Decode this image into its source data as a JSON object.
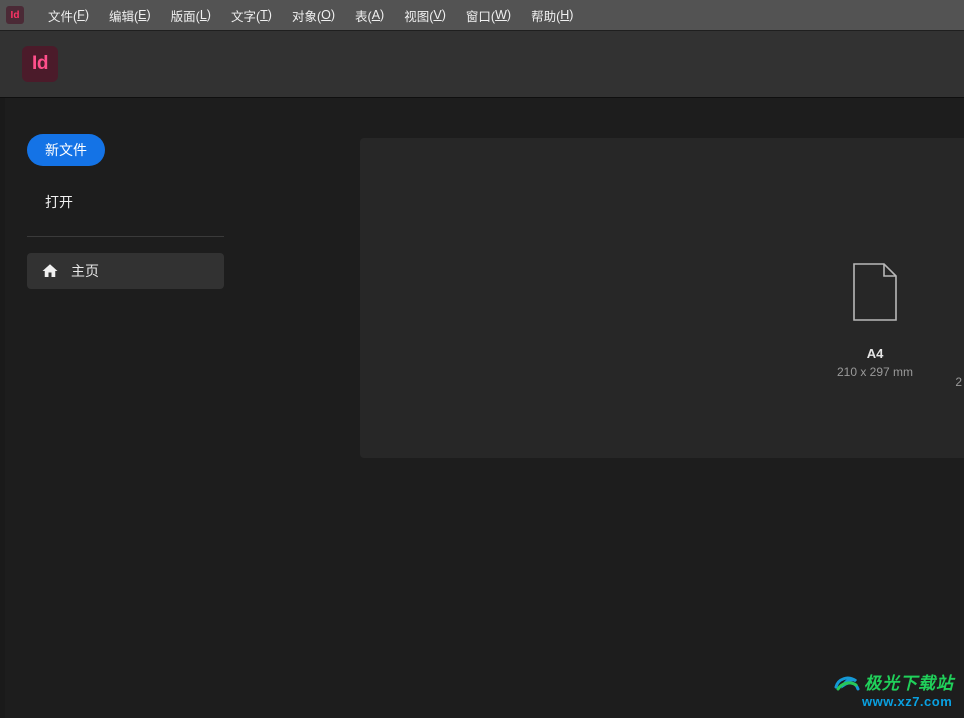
{
  "menubar": {
    "app_glyph": "Id",
    "items": [
      {
        "label_pre": "文件(",
        "hot": "F",
        "label_post": ")"
      },
      {
        "label_pre": "编辑(",
        "hot": "E",
        "label_post": ")"
      },
      {
        "label_pre": "版面(",
        "hot": "L",
        "label_post": ")"
      },
      {
        "label_pre": "文字(",
        "hot": "T",
        "label_post": ")"
      },
      {
        "label_pre": "对象(",
        "hot": "O",
        "label_post": ")"
      },
      {
        "label_pre": "表(",
        "hot": "A",
        "label_post": ")"
      },
      {
        "label_pre": "视图(",
        "hot": "V",
        "label_post": ")"
      },
      {
        "label_pre": "窗口(",
        "hot": "W",
        "label_post": ")"
      },
      {
        "label_pre": "帮助(",
        "hot": "H",
        "label_post": ")"
      }
    ]
  },
  "brand": {
    "logo_text": "Id"
  },
  "sidebar": {
    "new_file": "新文件",
    "open": "打开",
    "home": "主页"
  },
  "presets": {
    "a4": {
      "title": "A4",
      "dim": "210 x 297 mm"
    },
    "more_hint": "2"
  },
  "watermark": {
    "title": "极光下载站",
    "url": "www.xz7.com"
  }
}
